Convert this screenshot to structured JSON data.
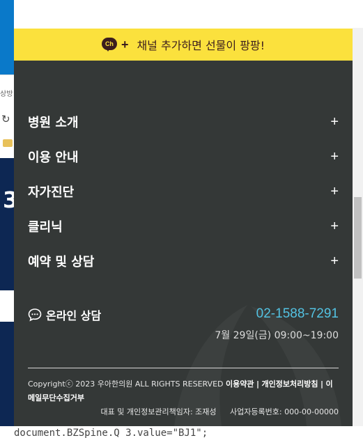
{
  "background": {
    "tab_fragment": "상방 •",
    "big_char": "3",
    "code_line": "document.BZSpine.Q_3.value=\"BJ1\";"
  },
  "banner": {
    "ch_icon_text": "Ch",
    "plus": "+",
    "text": "채널 추가하면 선물이 팡팡!",
    "color": "#fbe13d"
  },
  "menu": {
    "items": [
      {
        "label": "병원 소개",
        "expand": "+"
      },
      {
        "label": "이용 안내",
        "expand": "+"
      },
      {
        "label": "자가진단",
        "expand": "+"
      },
      {
        "label": "클리닉",
        "expand": "+"
      },
      {
        "label": "예약 및 상담",
        "expand": "+"
      }
    ]
  },
  "contact": {
    "consult_label": "온라인 상담",
    "phone": "02-1588-7291",
    "hours": "7월 29일(금) 09:00~19:00",
    "phone_color": "#53c2e2"
  },
  "footer": {
    "copyright": "Copyrightⓒ 2023 우아한의원 ALL RIGHTS RESERVED",
    "links": [
      "이용약관",
      "개인정보처리방침",
      "이메일무단수집거부"
    ],
    "separator": "|",
    "representative": "대표 및 개인정보관리책임자: 조재성",
    "business_number": "사업자등록번호: 000-00-00000"
  },
  "colors": {
    "drawer_bg": "#343837",
    "text_white": "#ffffff"
  }
}
